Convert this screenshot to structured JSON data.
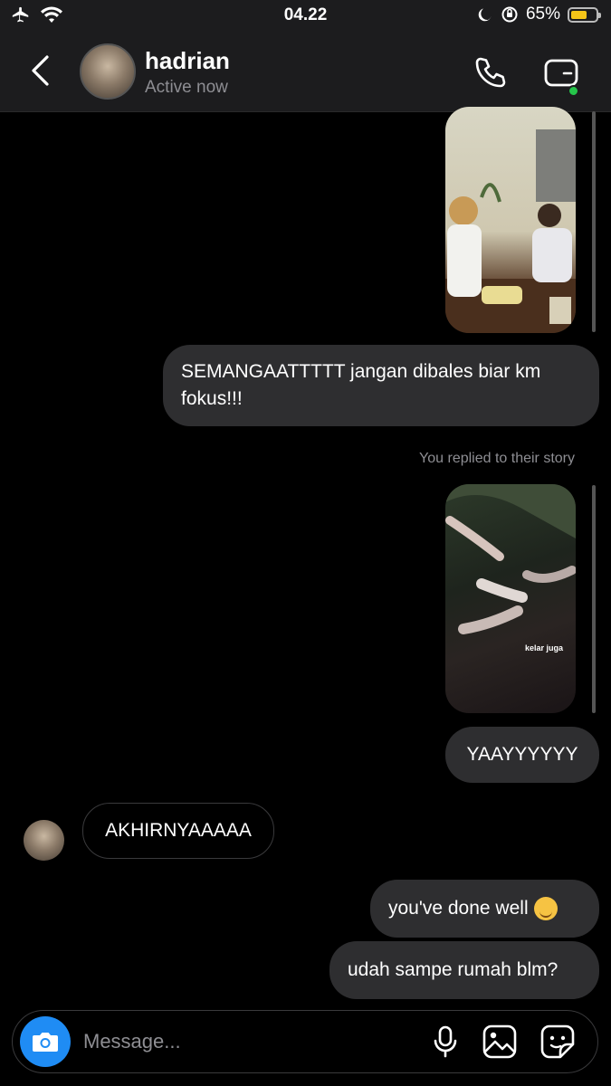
{
  "status_bar": {
    "time": "04.22",
    "battery": "65%",
    "battery_level": 0.65
  },
  "header": {
    "name": "hadrian",
    "status": "Active now"
  },
  "messages": {
    "m1": "SEMANGAATTTTT jangan dibales biar km fokus!!!",
    "meta": "You replied to their story",
    "m2": "YAAYYYYYY",
    "m3": "AKHIRNYAAAAA",
    "m4": "you've done well",
    "m5": "udah sampe rumah blm?"
  },
  "story2": {
    "caption": "kelar juga"
  },
  "composer": {
    "placeholder": "Message..."
  },
  "colors": {
    "accent": "#1f8cf4",
    "online": "#25c54a",
    "bubble_out": "#2e2e30",
    "battery": "#f5c518"
  }
}
